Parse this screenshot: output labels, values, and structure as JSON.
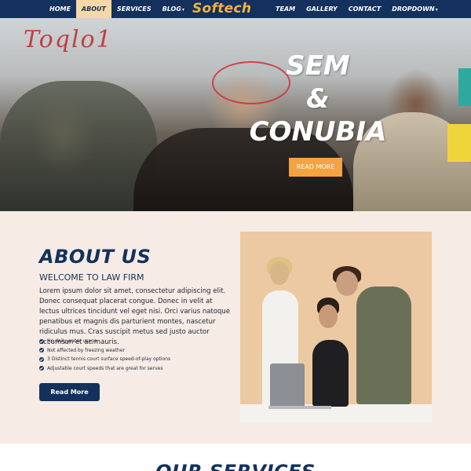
{
  "nav": {
    "left_items": [
      {
        "label": "HOME",
        "active": false
      },
      {
        "label": "ABOUT",
        "active": true
      },
      {
        "label": "SERVICES",
        "active": false
      },
      {
        "label": "BLOG",
        "active": false,
        "dropdown": true
      }
    ],
    "logo": "Softech",
    "right_items": [
      {
        "label": "TEAM",
        "active": false
      },
      {
        "label": "GALLERY",
        "active": false
      },
      {
        "label": "CONTACT",
        "active": false
      },
      {
        "label": "DROPDOWN",
        "active": false,
        "dropdown": true
      }
    ],
    "colors": {
      "bar": "#13315c",
      "active_bg": "#f6d8a6",
      "logo": "#f4b33b"
    }
  },
  "hero": {
    "title_line1": "SEM",
    "title_line2": "&",
    "title_line3": "CONUBIA",
    "button_label": "READ MORE",
    "button_color": "#f4a341",
    "scribble_text": "Toqlo1"
  },
  "about": {
    "title": "ABOUT US",
    "subtitle": "WELCOME TO LAW FIRM",
    "paragraph": "Lorem ipsum dolor sit amet, consectetur adipiscing elit. Donec consequat placerat congue. Donec in velit at lectus ultrices tincidunt vel eget nisi. Orci varius natoque penatibus et magnis dis parturient montes, nascetur ridiculus mus. Cras suscipit metus sed justo auctor accumsan et ac mauris.",
    "checklist": [
      "No daily water usage",
      "Not affected by freezing weather",
      "3 Distinct tennis court surface speed-of-play options",
      "Adjustable court speeds that are great for serves"
    ],
    "button_label": "Read More",
    "background": "#f6ebe5"
  },
  "services": {
    "title": "OUR SERVICES"
  }
}
